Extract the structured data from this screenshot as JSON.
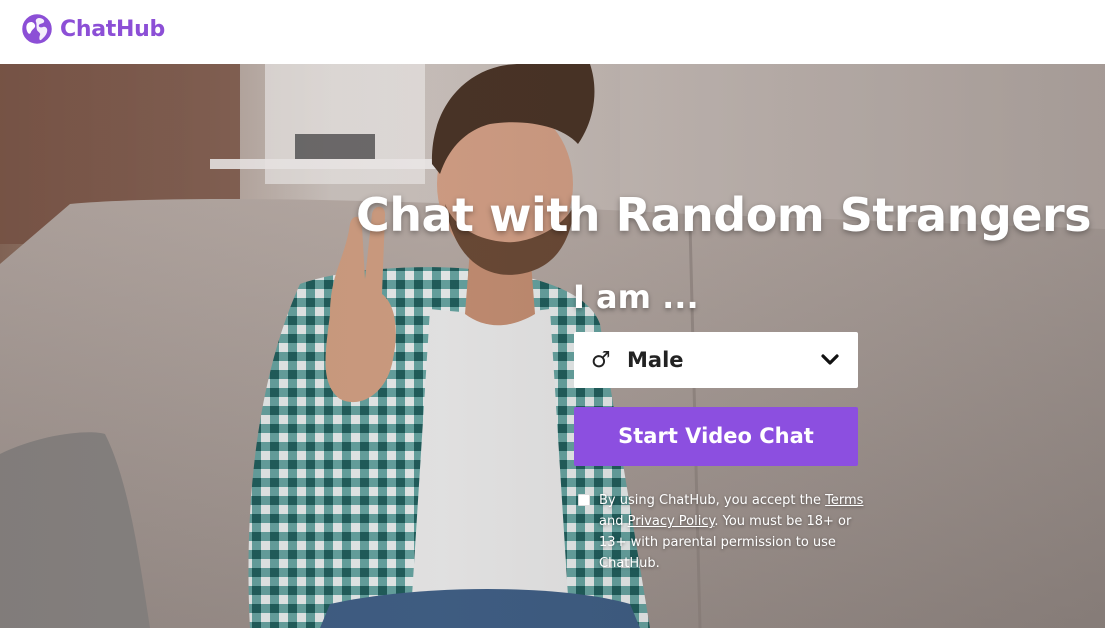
{
  "header": {
    "brand": "ChatHub",
    "brand_color": "#8c4fd6",
    "logo_icon": "globe-logo-icon"
  },
  "hero": {
    "headline": "Chat with Random Strangers",
    "prompt": "I am ...",
    "gender_select": {
      "selected": "Male",
      "icon": "male-symbol-icon",
      "icon_glyph": "♂",
      "chevron_icon": "chevron-down-icon"
    },
    "start_button": "Start Video Chat",
    "accent_color": "#8c4fe0",
    "consent": {
      "prefix": "By using ChatHub, you accept the",
      "terms_link": "Terms",
      "and": "and",
      "privacy_link": "Privacy Policy",
      "suffix": ". You must be 18+ or 13+ with parental permission to use ChatHub."
    }
  }
}
